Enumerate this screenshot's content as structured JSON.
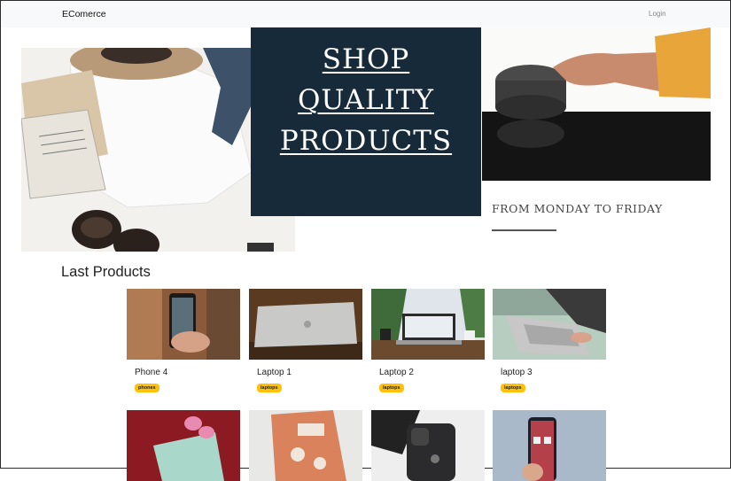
{
  "navbar": {
    "brand": "EComerce",
    "login": "Login"
  },
  "hero": {
    "title_lines": [
      "SHOP",
      "QUALITY",
      "PRODUCTS"
    ],
    "subtitle": "FROM MONDAY TO FRIDAY",
    "colors": {
      "box": "#172a3a"
    }
  },
  "products": {
    "heading": "Last Products",
    "items": [
      {
        "name": "Phone 4",
        "category": "phones"
      },
      {
        "name": "Laptop 1",
        "category": "laptops"
      },
      {
        "name": "Laptop 2",
        "category": "laptops"
      },
      {
        "name": "laptop 3",
        "category": "laptops"
      }
    ]
  },
  "badge_color": "#ffc107"
}
